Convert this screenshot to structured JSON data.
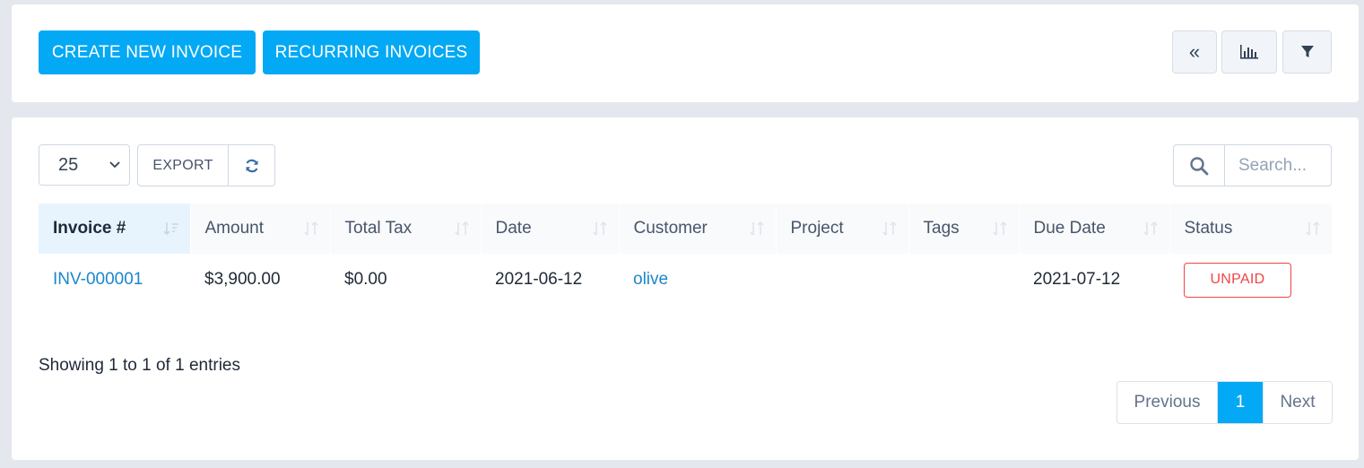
{
  "toolbar": {
    "create_label": "CREATE NEW INVOICE",
    "recurring_label": "RECURRING INVOICES",
    "collapse_icon": "double-chevron-left-icon",
    "chart_icon": "bar-chart-icon",
    "filter_icon": "filter-icon"
  },
  "controls": {
    "page_length": "25",
    "export_label": "EXPORT",
    "reload_icon": "refresh-icon",
    "search_icon": "search-icon",
    "search_placeholder": "Search..."
  },
  "table": {
    "columns": [
      "Invoice #",
      "Amount",
      "Total Tax",
      "Date",
      "Customer",
      "Project",
      "Tags",
      "Due Date",
      "Status"
    ],
    "rows": [
      {
        "invoice": "INV-000001",
        "amount": "$3,900.00",
        "total_tax": "$0.00",
        "date": "2021-06-12",
        "customer": "olive",
        "project": "",
        "tags": "",
        "due_date": "2021-07-12",
        "status": "UNPAID"
      }
    ]
  },
  "footer": {
    "info": "Showing 1 to 1 of 1 entries",
    "previous_label": "Previous",
    "current_page": "1",
    "next_label": "Next"
  },
  "colors": {
    "accent": "#03a9f4",
    "link": "#1b87c9",
    "unpaid": "#ef4444"
  }
}
